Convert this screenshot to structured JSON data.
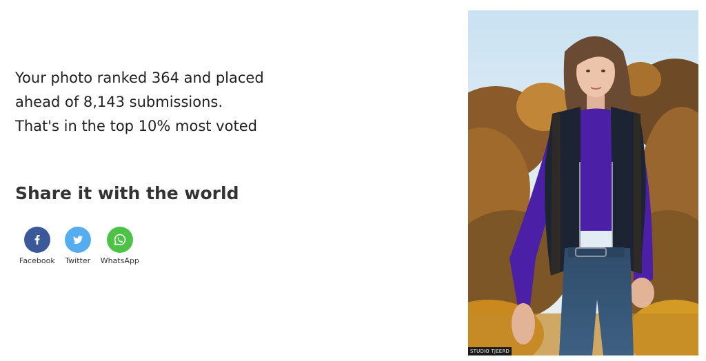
{
  "result": {
    "line1": "Your photo ranked 364 and placed",
    "line2": "ahead of 8,143 submissions.",
    "line3": "That's in the top 10% most voted"
  },
  "share": {
    "heading": "Share it with the world",
    "buttons": [
      {
        "label": "Facebook",
        "icon": "facebook-icon",
        "color": "#3b5998"
      },
      {
        "label": "Twitter",
        "icon": "twitter-icon",
        "color": "#55acee"
      },
      {
        "label": "WhatsApp",
        "icon": "whatsapp-icon",
        "color": "#4dc247"
      }
    ]
  },
  "photo": {
    "watermark": "STUDIO TJEERD"
  }
}
